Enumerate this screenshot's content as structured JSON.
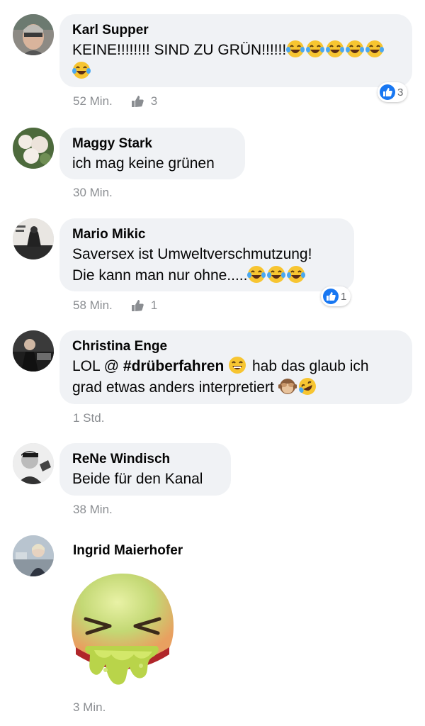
{
  "comments": [
    {
      "author": "Karl Supper",
      "text": "KEINE!!!!!!!! SIND ZU GRÜN!!!!!!",
      "time": "52 Min.",
      "likes": "3",
      "reaction_count": "3"
    },
    {
      "author": "Maggy Stark",
      "text": "ich mag keine grünen",
      "time": "30 Min."
    },
    {
      "author": "Mario Mikic",
      "text_line1": "Saversex ist Umweltverschmutzung!",
      "text_line2": "Die kann man nur ohne.....",
      "time": "58 Min.",
      "likes": "1",
      "reaction_count": "1"
    },
    {
      "author": "Christina Enge",
      "text_part1": "LOL @ ",
      "hashtag": "#drüberfahren",
      "text_part2": " hab das glaub ich",
      "text_line2": "grad etwas anders interpretiert",
      "time": "1 Std."
    },
    {
      "author": "ReNe Windisch",
      "text": "Beide für den Kanal",
      "time": "38 Min."
    },
    {
      "author": "Ingrid Maierhofer",
      "sticker": "nauseated-face-sticker",
      "time": "3 Min."
    }
  ],
  "colors": {
    "bubble": "#f0f2f5",
    "meta": "#8a8d91",
    "like_blue": "#1877f2"
  }
}
